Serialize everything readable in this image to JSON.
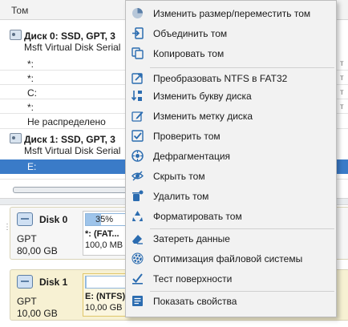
{
  "volume_list": {
    "column_header": "Том",
    "disk0": {
      "title": "Диск 0: SSD, GPT, 3",
      "subtitle": "Msft Virtual Disk Serial"
    },
    "disk0_volumes": [
      "*:",
      "*:",
      "C:",
      "*:",
      "Не распределено"
    ],
    "disk1": {
      "title": "Диск 1: SSD, GPT, 3",
      "subtitle": "Msft Virtual Disk Serial"
    },
    "selected_volume": "E:"
  },
  "disk_map": {
    "disk0": {
      "name": "Disk 0",
      "type": "GPT",
      "size": "80,00 GB",
      "partition_label": "*: (FAT...",
      "partition_size": "100,0 MB",
      "usage_percent": 35,
      "usage_text": "35%"
    },
    "disk1": {
      "name": "Disk 1",
      "type": "GPT",
      "size": "10,00 GB",
      "partition_label": "E: (NTFS)",
      "partition_size": "10,00 GB",
      "usage_percent": 2
    }
  },
  "context_menu": {
    "items": [
      {
        "label": "Изменить размер/переместить том",
        "icon": "resize-pie-icon",
        "color": "#2b6cb0"
      },
      {
        "label": "Объединить том",
        "icon": "merge-icon",
        "color": "#2b6cb0"
      },
      {
        "label": "Копировать том",
        "icon": "copy-icon",
        "color": "#2b6cb0"
      },
      {
        "label": "Преобразовать NTFS в FAT32",
        "icon": "convert-icon",
        "color": "#2b6cb0"
      },
      {
        "label": "Изменить букву диска",
        "icon": "drive-letter-icon",
        "color": "#2b6cb0"
      },
      {
        "label": "Изменить метку диска",
        "icon": "edit-label-icon",
        "color": "#2b6cb0"
      },
      {
        "label": "Проверить том",
        "icon": "check-icon",
        "color": "#2b6cb0"
      },
      {
        "label": "Дефрагментация",
        "icon": "defrag-icon",
        "color": "#2b6cb0"
      },
      {
        "label": "Скрыть том",
        "icon": "hide-eye-icon",
        "color": "#2b6cb0"
      },
      {
        "label": "Удалить том",
        "icon": "delete-icon",
        "color": "#2b6cb0"
      },
      {
        "label": "Форматировать том",
        "icon": "format-recycle-icon",
        "color": "#2b6cb0"
      },
      {
        "label": "Затереть данные",
        "icon": "eraser-icon",
        "color": "#2b6cb0"
      },
      {
        "label": "Оптимизация файловой системы",
        "icon": "optimize-gear-icon",
        "color": "#2b6cb0"
      },
      {
        "label": "Тест поверхности",
        "icon": "surface-test-icon",
        "color": "#2b6cb0"
      },
      {
        "label": "Показать свойства",
        "icon": "properties-icon",
        "color": "#2b6cb0"
      }
    ]
  },
  "colors": {
    "selection": "#3a7bc8",
    "menu_bg": "#f2f2f2",
    "icon_blue": "#2b6cb0",
    "disk1_card": "#f7f1d3"
  }
}
